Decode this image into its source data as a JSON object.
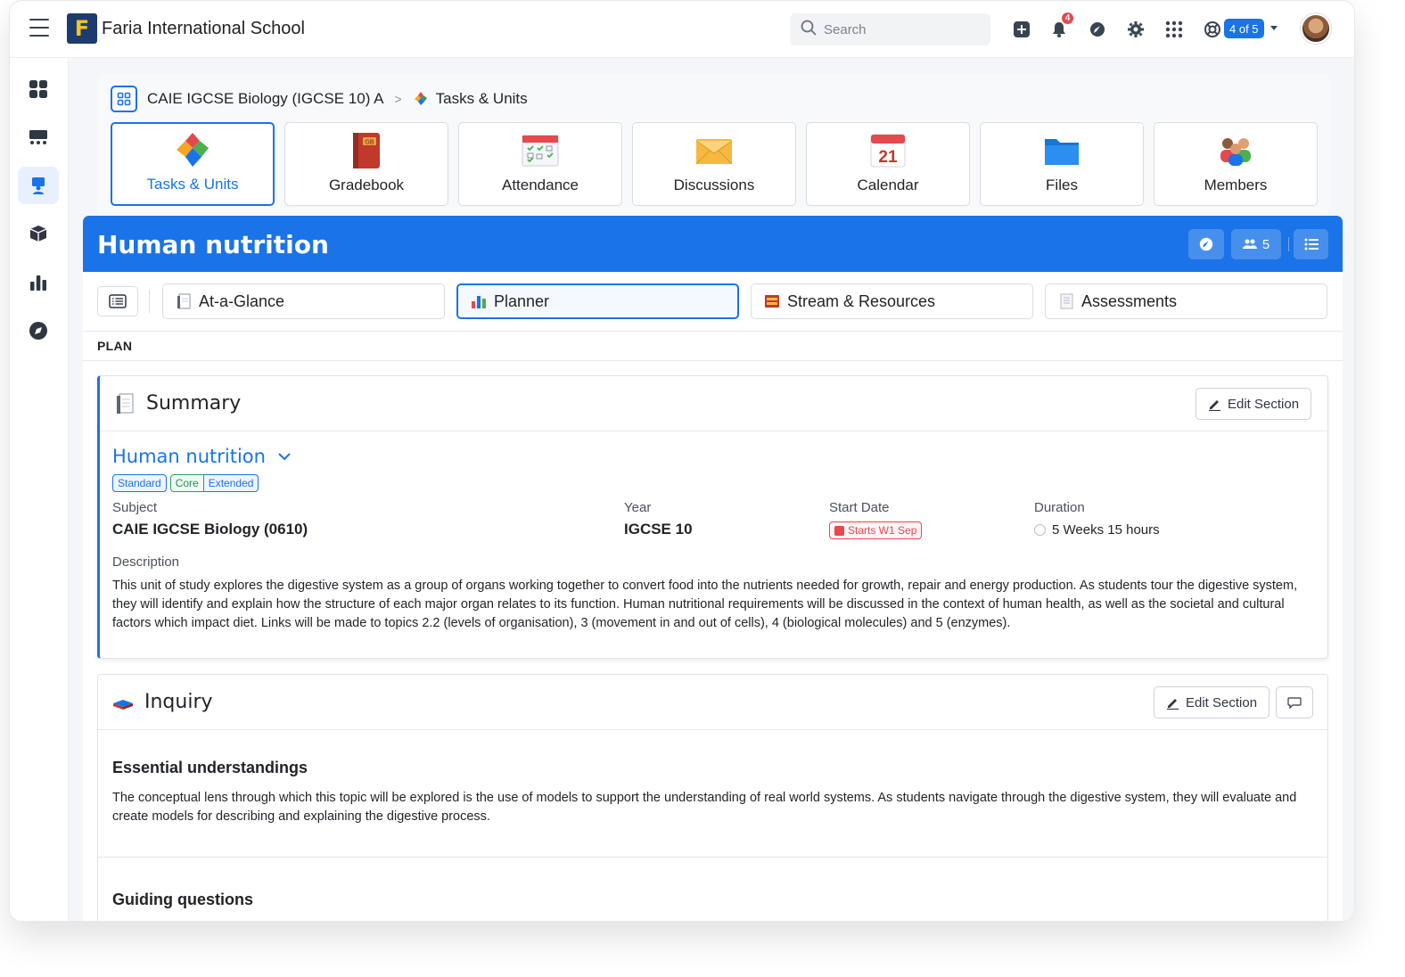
{
  "topbar": {
    "school_name": "Faria International School",
    "logo_letter": "F",
    "search_placeholder": "Search",
    "notification_count": "4",
    "account_switch": "4 of 5"
  },
  "sidebar": {
    "items": [
      {
        "icon": "dashboard-grid-icon"
      },
      {
        "icon": "classes-icon"
      },
      {
        "icon": "teacher-icon",
        "active": true
      },
      {
        "icon": "cube-icon"
      },
      {
        "icon": "analytics-icon"
      },
      {
        "icon": "compass-icon"
      }
    ]
  },
  "breadcrumb": {
    "class_name": "CAIE IGCSE Biology (IGCSE 10) A",
    "separator": ">",
    "current": "Tasks & Units"
  },
  "app_tiles": [
    {
      "label": "Tasks & Units",
      "icon": "puzzle-icon",
      "active": true
    },
    {
      "label": "Gradebook",
      "icon": "gradebook-icon"
    },
    {
      "label": "Attendance",
      "icon": "attendance-icon"
    },
    {
      "label": "Discussions",
      "icon": "envelope-icon"
    },
    {
      "label": "Calendar",
      "icon": "calendar-icon",
      "day": "21"
    },
    {
      "label": "Files",
      "icon": "folder-icon"
    },
    {
      "label": "Members",
      "icon": "people-icon"
    }
  ],
  "unit": {
    "title": "Human nutrition",
    "member_count": "5"
  },
  "subtabs": [
    {
      "label": "At-a-Glance",
      "icon": "glance-icon"
    },
    {
      "label": "Planner",
      "icon": "planner-icon",
      "active": true
    },
    {
      "label": "Stream & Resources",
      "icon": "stream-icon"
    },
    {
      "label": "Assessments",
      "icon": "assessment-icon"
    }
  ],
  "plan_label": "PLAN",
  "summary": {
    "title": "Summary",
    "edit_label": "Edit Section",
    "unit_name": "Human nutrition",
    "tags": [
      "Standard",
      "Core",
      "Extended"
    ],
    "subject_label": "Subject",
    "subject_value": "CAIE IGCSE Biology (0610)",
    "year_label": "Year",
    "year_value": "IGCSE 10",
    "start_label": "Start Date",
    "start_value": "Starts W1 Sep",
    "duration_label": "Duration",
    "duration_value": "5 Weeks 15 hours",
    "description_label": "Description",
    "description": "This unit of study explores the digestive system as a group of organs working together to convert food into the nutrients needed for growth, repair and energy production. As students tour the digestive system, they will identify and explain how the structure of each major organ relates to its function. Human nutritional requirements will be discussed in the context of human health, as well as the societal and cultural factors which impact diet. Links will be made to topics 2.2 (levels of organisation), 3 (movement in and out of cells), 4 (biological molecules) and 5 (enzymes)."
  },
  "inquiry": {
    "title": "Inquiry",
    "edit_label": "Edit Section",
    "essential_heading": "Essential understandings",
    "essential_text": "The conceptual lens through which this topic will be explored is the use of models to support the understanding of real world systems. As students navigate through the digestive system, they will evaluate and create models for describing and explaining the digestive process.",
    "guiding_heading": "Guiding questions"
  },
  "colors": {
    "accent": "#1a73e8",
    "alert": "#e5484d",
    "core_tag": "#2e9b63"
  }
}
